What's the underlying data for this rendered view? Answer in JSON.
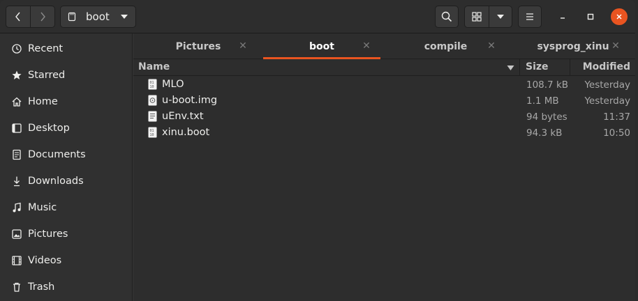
{
  "window": {
    "path_label": "boot"
  },
  "sidebar": {
    "items": [
      {
        "label": "Recent",
        "icon": "clock-icon"
      },
      {
        "label": "Starred",
        "icon": "star-icon"
      },
      {
        "label": "Home",
        "icon": "home-icon"
      },
      {
        "label": "Desktop",
        "icon": "desktop-icon"
      },
      {
        "label": "Documents",
        "icon": "document-icon"
      },
      {
        "label": "Downloads",
        "icon": "download-icon"
      },
      {
        "label": "Music",
        "icon": "music-icon"
      },
      {
        "label": "Pictures",
        "icon": "picture-icon"
      },
      {
        "label": "Videos",
        "icon": "video-icon"
      },
      {
        "label": "Trash",
        "icon": "trash-icon"
      }
    ]
  },
  "tabs": [
    {
      "label": "Pictures",
      "active": false
    },
    {
      "label": "boot",
      "active": true
    },
    {
      "label": "compile",
      "active": false
    },
    {
      "label": "sysprog_xinu",
      "active": false
    }
  ],
  "columns": {
    "name": "Name",
    "size": "Size",
    "modified": "Modified"
  },
  "files": [
    {
      "name": "MLO",
      "size": "108.7 kB",
      "modified": "Yesterday",
      "icon": "binary-file-icon"
    },
    {
      "name": "u-boot.img",
      "size": "1.1 MB",
      "modified": "Yesterday",
      "icon": "disk-image-file-icon"
    },
    {
      "name": "uEnv.txt",
      "size": "94 bytes",
      "modified": "11:37",
      "icon": "text-file-icon"
    },
    {
      "name": "xinu.boot",
      "size": "94.3 kB",
      "modified": "10:50",
      "icon": "binary-file-icon"
    }
  ],
  "colors": {
    "accent": "#e95420"
  }
}
